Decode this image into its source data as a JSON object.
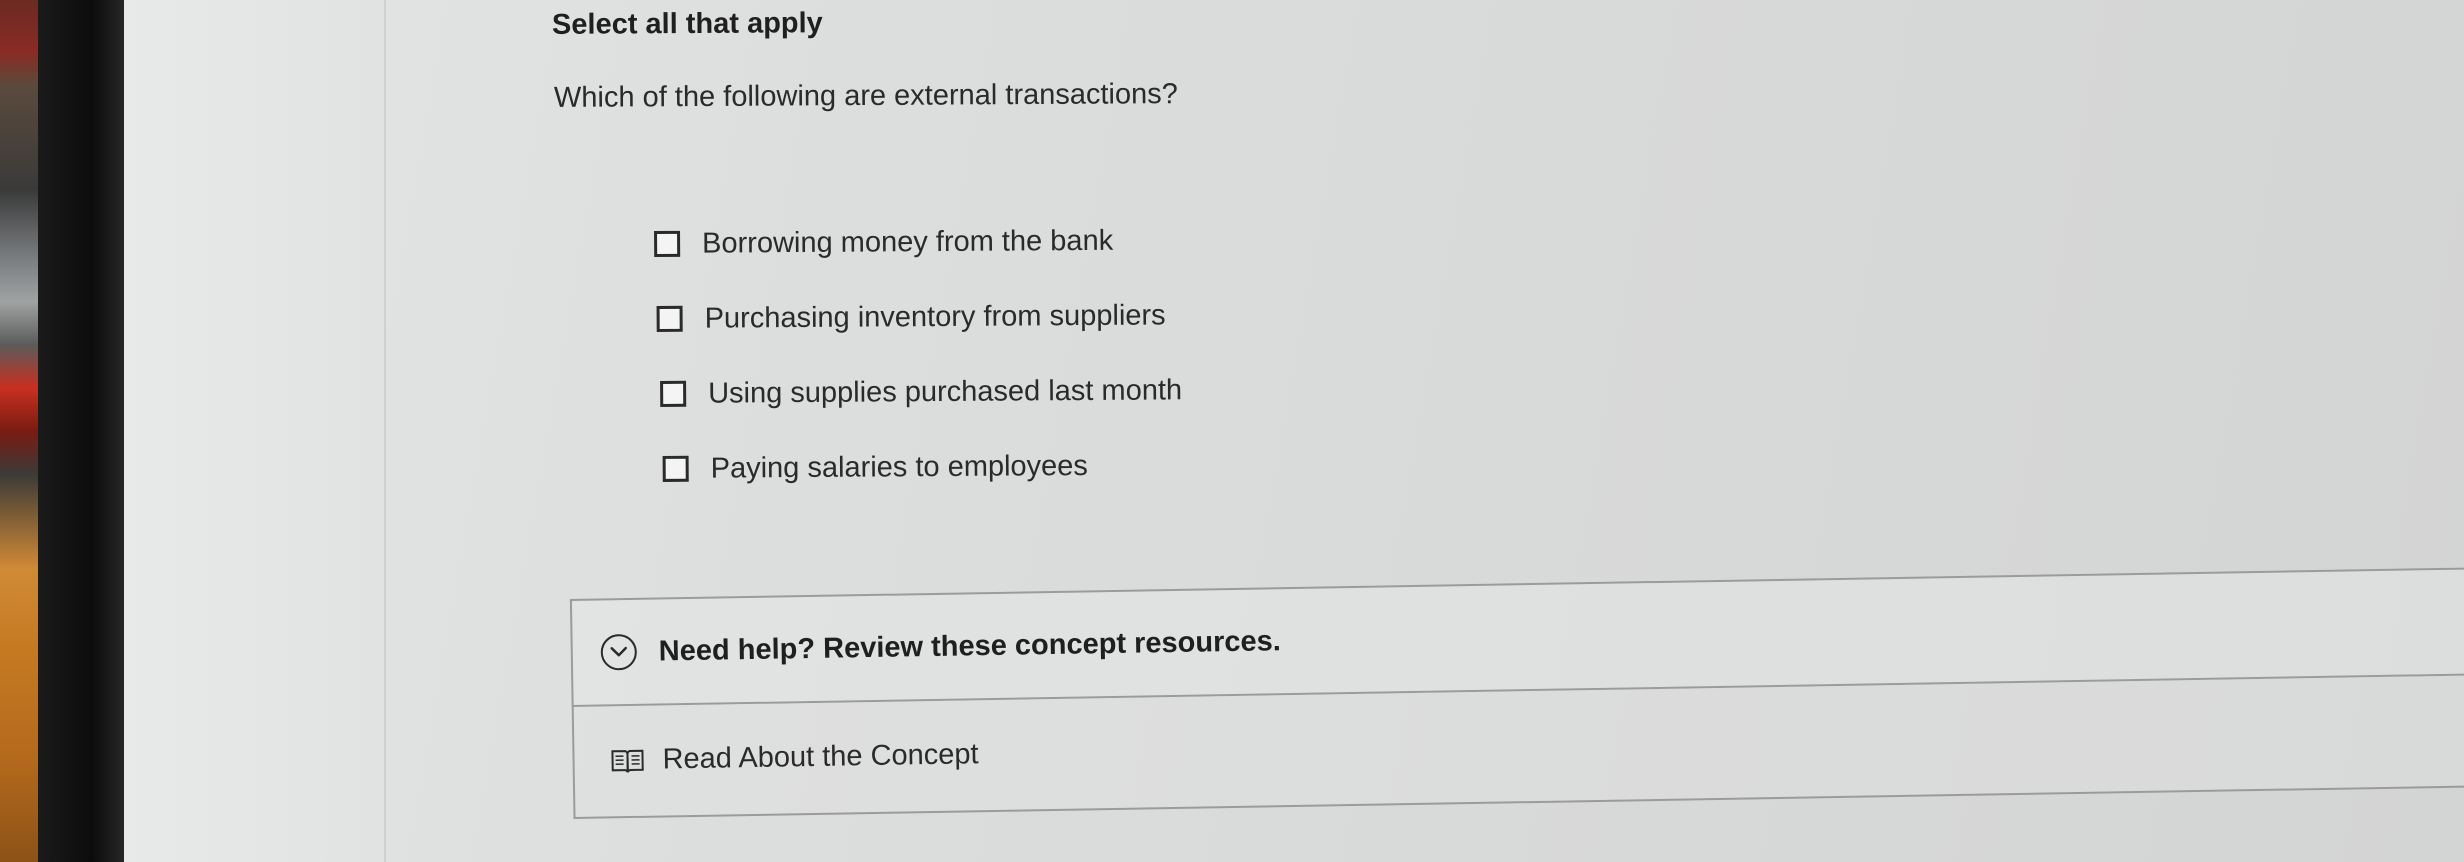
{
  "question": {
    "instruction": "Select all that apply",
    "prompt": "Which of the following are external transactions?",
    "options": [
      {
        "label": "Borrowing money from the bank",
        "checked": false
      },
      {
        "label": "Purchasing inventory from suppliers",
        "checked": false
      },
      {
        "label": "Using supplies purchased last month",
        "checked": false
      },
      {
        "label": "Paying salaries to employees",
        "checked": false
      }
    ]
  },
  "help": {
    "title": "Need help? Review these concept resources.",
    "expand_icon": "chevron-down-circle-icon",
    "resources": [
      {
        "label": "Read About the Concept",
        "icon": "book-icon"
      }
    ]
  },
  "colors": {
    "text": "#2a2a2a",
    "border": "#9a9c9c",
    "background": "#dcdede"
  }
}
